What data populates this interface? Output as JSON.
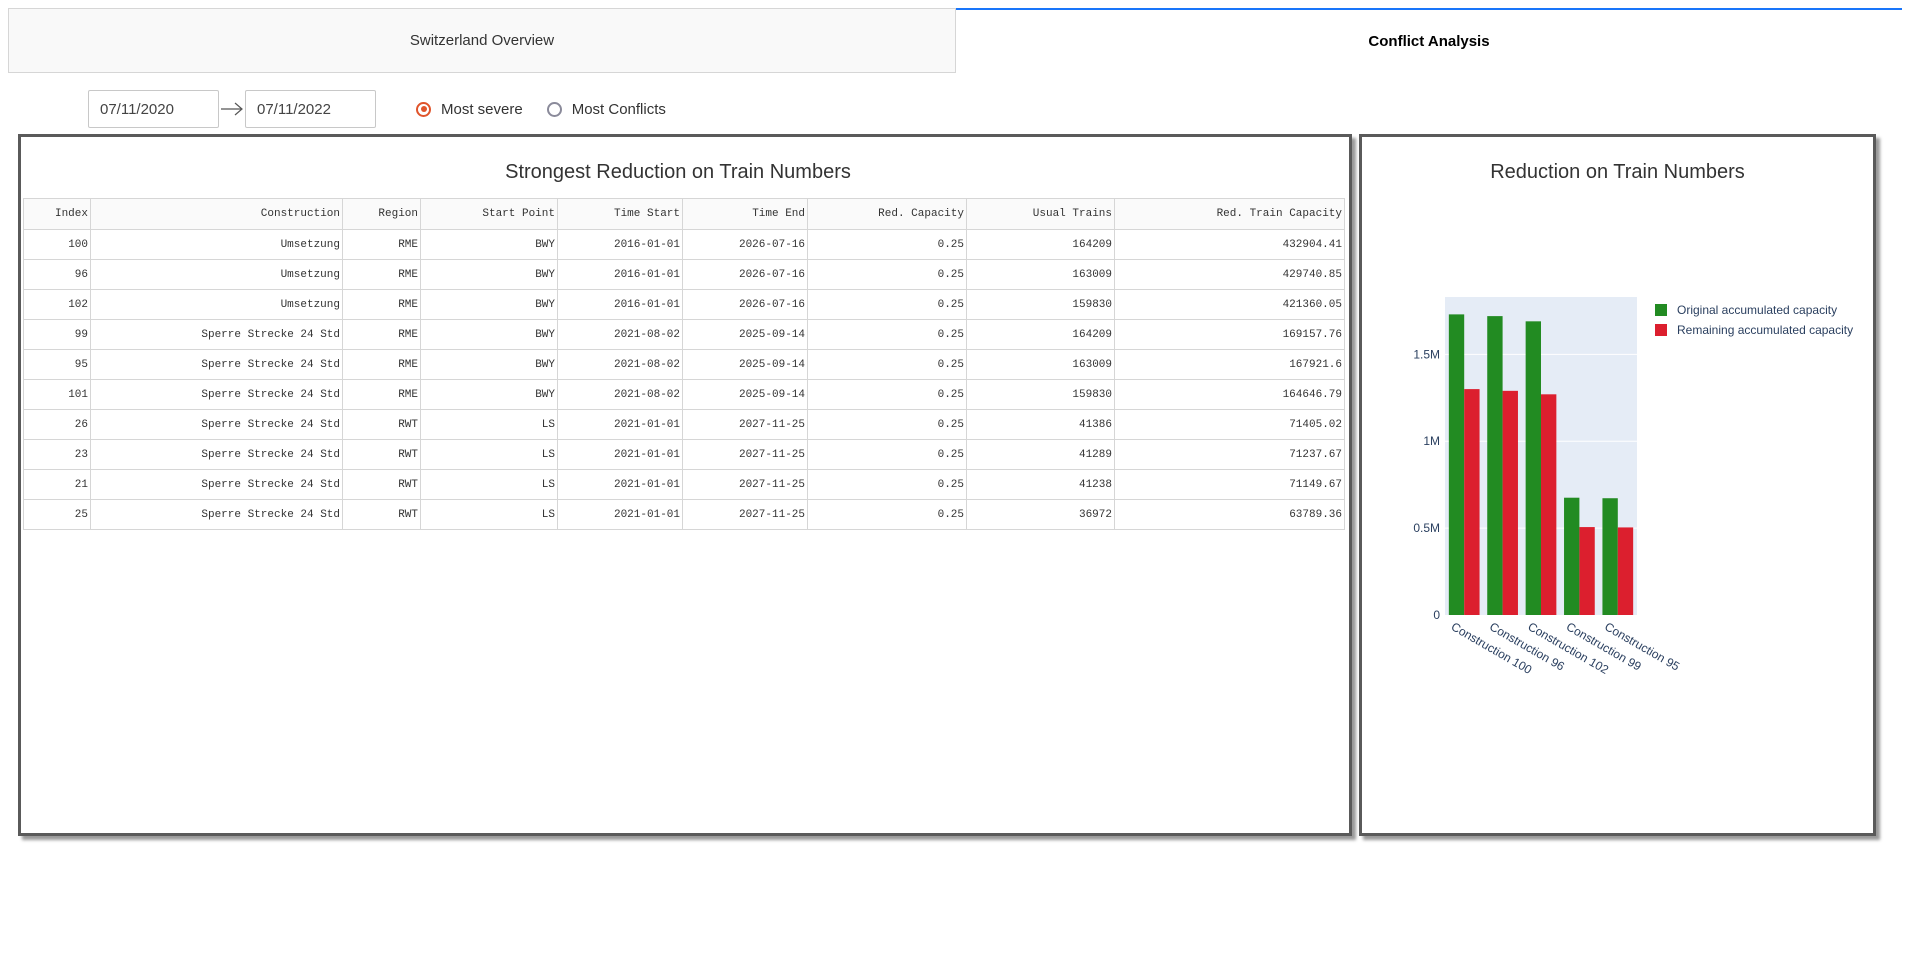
{
  "tabs": [
    {
      "label": "Switzerland Overview",
      "active": false
    },
    {
      "label": "Conflict Analysis",
      "active": true
    }
  ],
  "date_range": {
    "start": "07/11/2020",
    "end": "07/11/2022"
  },
  "radio_options": [
    {
      "label": "Most severe",
      "checked": true
    },
    {
      "label": "Most Conflicts",
      "checked": false
    }
  ],
  "table_panel": {
    "title": "Strongest Reduction on Train Numbers",
    "columns": [
      "Index",
      "Construction",
      "Region",
      "Start Point",
      "Time Start",
      "Time End",
      "Red. Capacity",
      "Usual Trains",
      "Red. Train Capacity"
    ],
    "rows": [
      [
        "100",
        "Umsetzung",
        "RME",
        "BWY",
        "2016-01-01",
        "2026-07-16",
        "0.25",
        "164209",
        "432904.41"
      ],
      [
        "96",
        "Umsetzung",
        "RME",
        "BWY",
        "2016-01-01",
        "2026-07-16",
        "0.25",
        "163009",
        "429740.85"
      ],
      [
        "102",
        "Umsetzung",
        "RME",
        "BWY",
        "2016-01-01",
        "2026-07-16",
        "0.25",
        "159830",
        "421360.05"
      ],
      [
        "99",
        "Sperre Strecke 24 Std",
        "RME",
        "BWY",
        "2021-08-02",
        "2025-09-14",
        "0.25",
        "164209",
        "169157.76"
      ],
      [
        "95",
        "Sperre Strecke 24 Std",
        "RME",
        "BWY",
        "2021-08-02",
        "2025-09-14",
        "0.25",
        "163009",
        "167921.6"
      ],
      [
        "101",
        "Sperre Strecke 24 Std",
        "RME",
        "BWY",
        "2021-08-02",
        "2025-09-14",
        "0.25",
        "159830",
        "164646.79"
      ],
      [
        "26",
        "Sperre Strecke 24 Std",
        "RWT",
        "LS",
        "2021-01-01",
        "2027-11-25",
        "0.25",
        "41386",
        "71405.02"
      ],
      [
        "23",
        "Sperre Strecke 24 Std",
        "RWT",
        "LS",
        "2021-01-01",
        "2027-11-25",
        "0.25",
        "41289",
        "71237.67"
      ],
      [
        "21",
        "Sperre Strecke 24 Std",
        "RWT",
        "LS",
        "2021-01-01",
        "2027-11-25",
        "0.25",
        "41238",
        "71149.67"
      ],
      [
        "25",
        "Sperre Strecke 24 Std",
        "RWT",
        "LS",
        "2021-01-01",
        "2027-11-25",
        "0.25",
        "36972",
        "63789.36"
      ]
    ]
  },
  "chart_data": {
    "type": "bar",
    "title": "Reduction on Train Numbers",
    "categories": [
      "Construction 100",
      "Construction 96",
      "Construction 102",
      "Construction 99",
      "Construction 95"
    ],
    "series": [
      {
        "name": "Original accumulated capacity",
        "color": "#228b22",
        "values": [
          1730000,
          1720000,
          1690000,
          675000,
          672000
        ]
      },
      {
        "name": "Remaining accumulated capacity",
        "color": "#dc1f2e",
        "values": [
          1300000,
          1290000,
          1270000,
          506000,
          504000
        ]
      }
    ],
    "ylim": [
      0,
      1830000
    ],
    "yticks": [
      {
        "value": 0,
        "label": "0"
      },
      {
        "value": 500000,
        "label": "0.5M"
      },
      {
        "value": 1000000,
        "label": "1M"
      },
      {
        "value": 1500000,
        "label": "1.5M"
      }
    ],
    "grid": true,
    "plot_background": "#e5ecf6",
    "legend_position": "right",
    "xlabel": "",
    "ylabel": ""
  }
}
